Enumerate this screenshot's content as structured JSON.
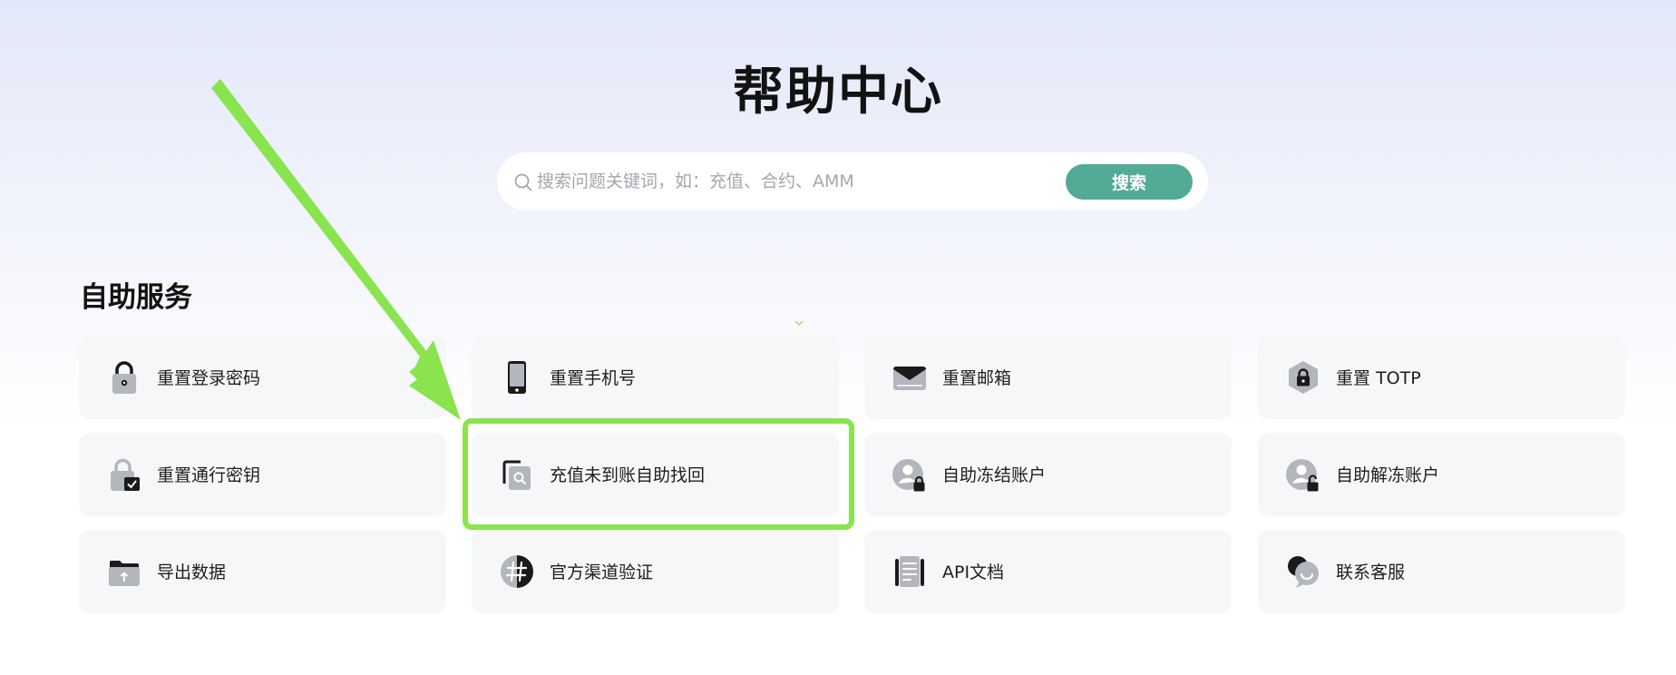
{
  "page": {
    "title": "帮助中心"
  },
  "search": {
    "placeholder": "搜索问题关键词，如：充值、合约、AMM",
    "button_label": "搜索"
  },
  "section": {
    "title": "自助服务"
  },
  "cards": [
    {
      "label": "重置登录密码",
      "icon": "lock-icon"
    },
    {
      "label": "重置手机号",
      "icon": "phone-icon"
    },
    {
      "label": "重置邮箱",
      "icon": "envelope-icon"
    },
    {
      "label": "重置 TOTP",
      "icon": "hexagon-lock-icon"
    },
    {
      "label": "重置通行密钥",
      "icon": "passkey-lock-icon"
    },
    {
      "label": "充值未到账自助找回",
      "icon": "document-search-icon"
    },
    {
      "label": "自助冻结账户",
      "icon": "user-lock-icon"
    },
    {
      "label": "自助解冻账户",
      "icon": "user-unlock-icon"
    },
    {
      "label": "导出数据",
      "icon": "folder-upload-icon"
    },
    {
      "label": "官方渠道验证",
      "icon": "hash-verify-icon"
    },
    {
      "label": "API文档",
      "icon": "document-icon"
    },
    {
      "label": "联系客服",
      "icon": "chat-bubble-icon"
    }
  ],
  "colors": {
    "accent": "#51ab96",
    "highlight": "#89e44f",
    "card_background": "#f6f7f9",
    "icon_gray": "#b3b6bc",
    "icon_dark": "#1a1a1a"
  }
}
